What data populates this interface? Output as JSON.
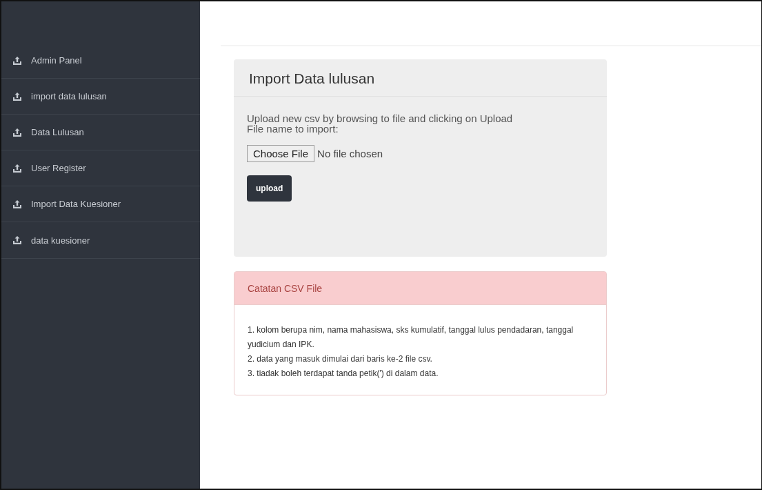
{
  "sidebar": {
    "items": [
      {
        "label": "Admin Panel"
      },
      {
        "label": "import data lulusan"
      },
      {
        "label": "Data Lulusan"
      },
      {
        "label": "User Register"
      },
      {
        "label": "Import Data Kuesioner"
      },
      {
        "label": "data kuesioner"
      }
    ]
  },
  "import_panel": {
    "title": "Import Data lulusan",
    "description": "Upload new csv by browsing to file and clicking on Upload",
    "file_label": "File name to import:",
    "choose_button": "Choose File",
    "file_status": "No file chosen",
    "upload_button": "upload"
  },
  "notes_panel": {
    "title": "Catatan CSV File",
    "lines": [
      "1. kolom berupa nim, nama mahasiswa, sks kumulatif, tanggal lulus pendadaran, tanggal yudicium dan IPK.",
      "2. data yang masuk dimulai dari baris ke-2 file csv.",
      "3. tiadak boleh terdapat tanda petik(') di dalam data."
    ]
  }
}
